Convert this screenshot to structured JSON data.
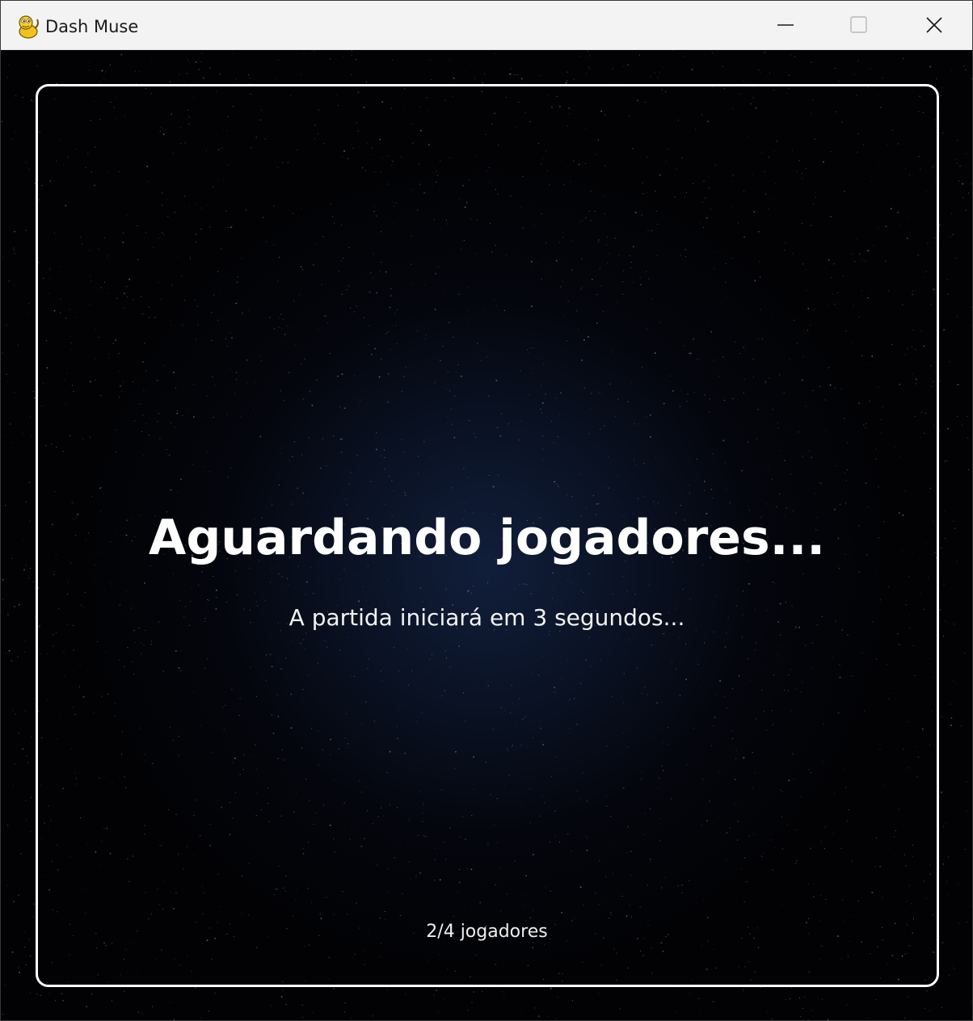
{
  "window": {
    "title": "Dash Muse",
    "app_icon": "snake-icon",
    "controls": {
      "minimize_icon": "minimize-icon",
      "maximize_icon": "maximize-icon",
      "close_icon": "close-icon"
    }
  },
  "lobby": {
    "headline": "Aguardando jogadores...",
    "countdown_text": "A partida iniciará em 3 segundos...",
    "player_count": "2/4 jogadores"
  },
  "colors": {
    "titlebar": "#f3f3f3",
    "background": "#020204",
    "glow": "#12203e",
    "text": "#ffffff",
    "frame": "#ffffff"
  }
}
